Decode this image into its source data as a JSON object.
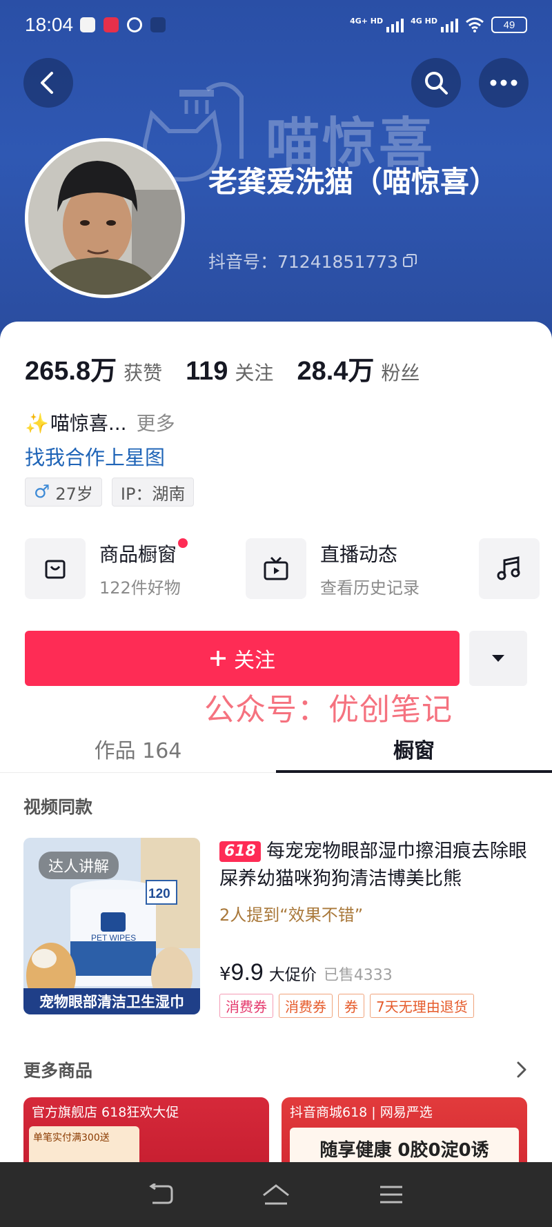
{
  "status_bar": {
    "time": "18:04",
    "signal1_label": "4G+ HD",
    "signal2_label": "4G HD",
    "battery": "49"
  },
  "header": {
    "watermark": "喵惊喜",
    "nickname": "老龚爱洗猫（喵惊喜）",
    "douyin_id": "抖音号：71241851773"
  },
  "stats": [
    {
      "value": "265.8万",
      "label": "获赞"
    },
    {
      "value": "119",
      "label": "关注"
    },
    {
      "value": "28.4万",
      "label": "粉丝"
    }
  ],
  "bio": {
    "text": "喵惊喜...",
    "more": "更多"
  },
  "cooperation_link": "找我合作上星图",
  "tags": {
    "age": "27岁",
    "ip": "IP：湖南"
  },
  "features": [
    {
      "title": "商品橱窗",
      "subtitle": "122件好物"
    },
    {
      "title": "直播动态",
      "subtitle": "查看历史记录"
    }
  ],
  "follow_button": "关注",
  "overlay_watermark": "公众号：优创笔记",
  "tabs": [
    {
      "label": "作品 164",
      "active": false
    },
    {
      "label": "橱窗",
      "active": true
    }
  ],
  "video_same_section": "视频同款",
  "product": {
    "badge": "达人讲解",
    "image_label_count": "120",
    "image_brand": "PET WIPES",
    "image_banner": "宠物眼部清洁卫生湿巾",
    "promo_badge": "618",
    "title": "每宠宠物眼部湿巾擦泪痕去除眼屎养幼猫咪狗狗清洁博美比熊",
    "mention": "2人提到“效果不错”",
    "price_symbol": "¥",
    "price": "9.9",
    "price_tag": "大促价",
    "sold": "已售4333",
    "coupons": [
      "消费券",
      "消费券",
      "券",
      "7天无理由退货"
    ]
  },
  "more_products_section": "更多商品",
  "cards": {
    "left_header": "官方旗舰店 618狂欢大促",
    "left_body": "单笔实付满300送",
    "right_header": "抖音商城618 | 网易严选",
    "right_body": "随享健康 0胶0淀0诱"
  },
  "colors": {
    "brand_red": "#fe2c55",
    "header_blue": "#2f58b3",
    "link_blue": "#1f64b7"
  }
}
